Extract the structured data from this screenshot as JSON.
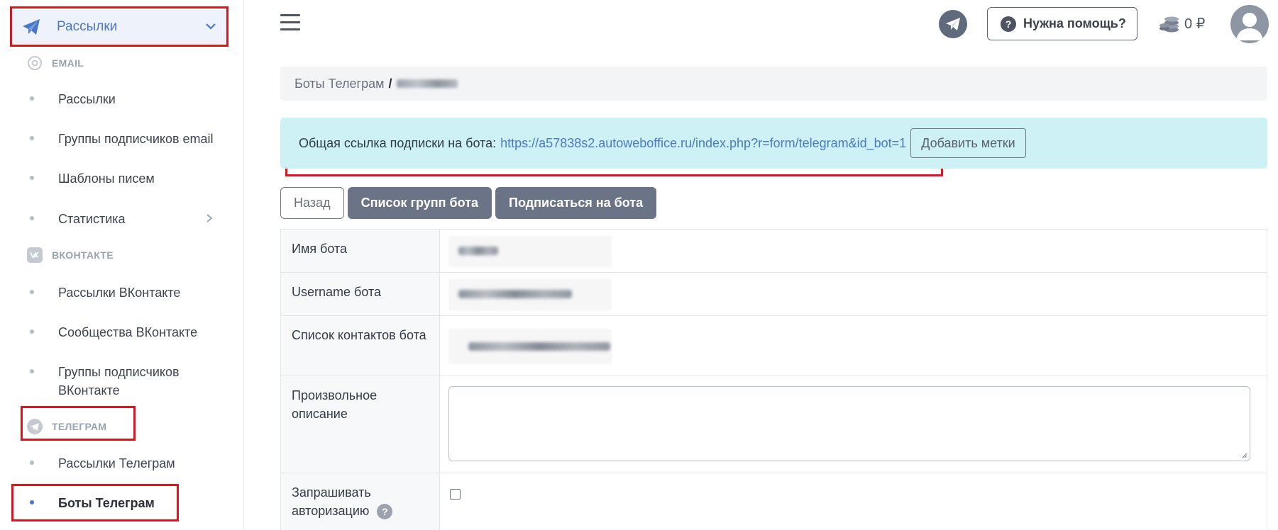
{
  "sidebar": {
    "top_item": {
      "label": "Рассылки",
      "icon": "paper-plane-icon"
    },
    "sections": {
      "email": {
        "label": "EMAIL",
        "icon": "at-icon"
      },
      "vk": {
        "label": "ВКОНТАКТЕ",
        "icon": "vk-icon"
      },
      "telegram": {
        "label": "ТЕЛЕГРАМ",
        "icon": "telegram-icon"
      }
    },
    "email_items": [
      "Рассылки",
      "Группы подписчиков email",
      "Шаблоны писем",
      "Статистика"
    ],
    "vk_items": [
      "Рассылки ВКонтакте",
      "Сообщества ВКонтакте",
      "Группы подписчиков ВКонтакте"
    ],
    "telegram_items": [
      "Рассылки Телеграм",
      "Боты Телеграм"
    ],
    "active_item": "Боты Телеграм"
  },
  "header": {
    "help_label": "Нужна помощь?",
    "help_icon": "question-circle-icon",
    "balance": "0 ₽",
    "balance_icon": "coins-icon"
  },
  "breadcrumb": {
    "parent": "Боты Телеграм",
    "separator": "/"
  },
  "notice": {
    "label": "Общая ссылка подписки на бота:",
    "link": "https://a57838s2.autoweboffice.ru/index.php?r=form/telegram&id_bot=1",
    "tags_button": "Добавить метки"
  },
  "buttons": {
    "back": "Назад",
    "groups": "Список групп бота",
    "subscribe": "Подписаться на бота"
  },
  "form": {
    "bot_name_label": "Имя бота",
    "username_label": "Username бота",
    "contacts_label": "Список контактов бота",
    "description_label": "Произвольное описание",
    "auth_label": "Запрашивать авторизацию"
  },
  "colors": {
    "accent": "#4a78c7",
    "highlight": "#e0141e",
    "notice_bg": "#cdf1f4",
    "button_dark": "#6b7486"
  }
}
